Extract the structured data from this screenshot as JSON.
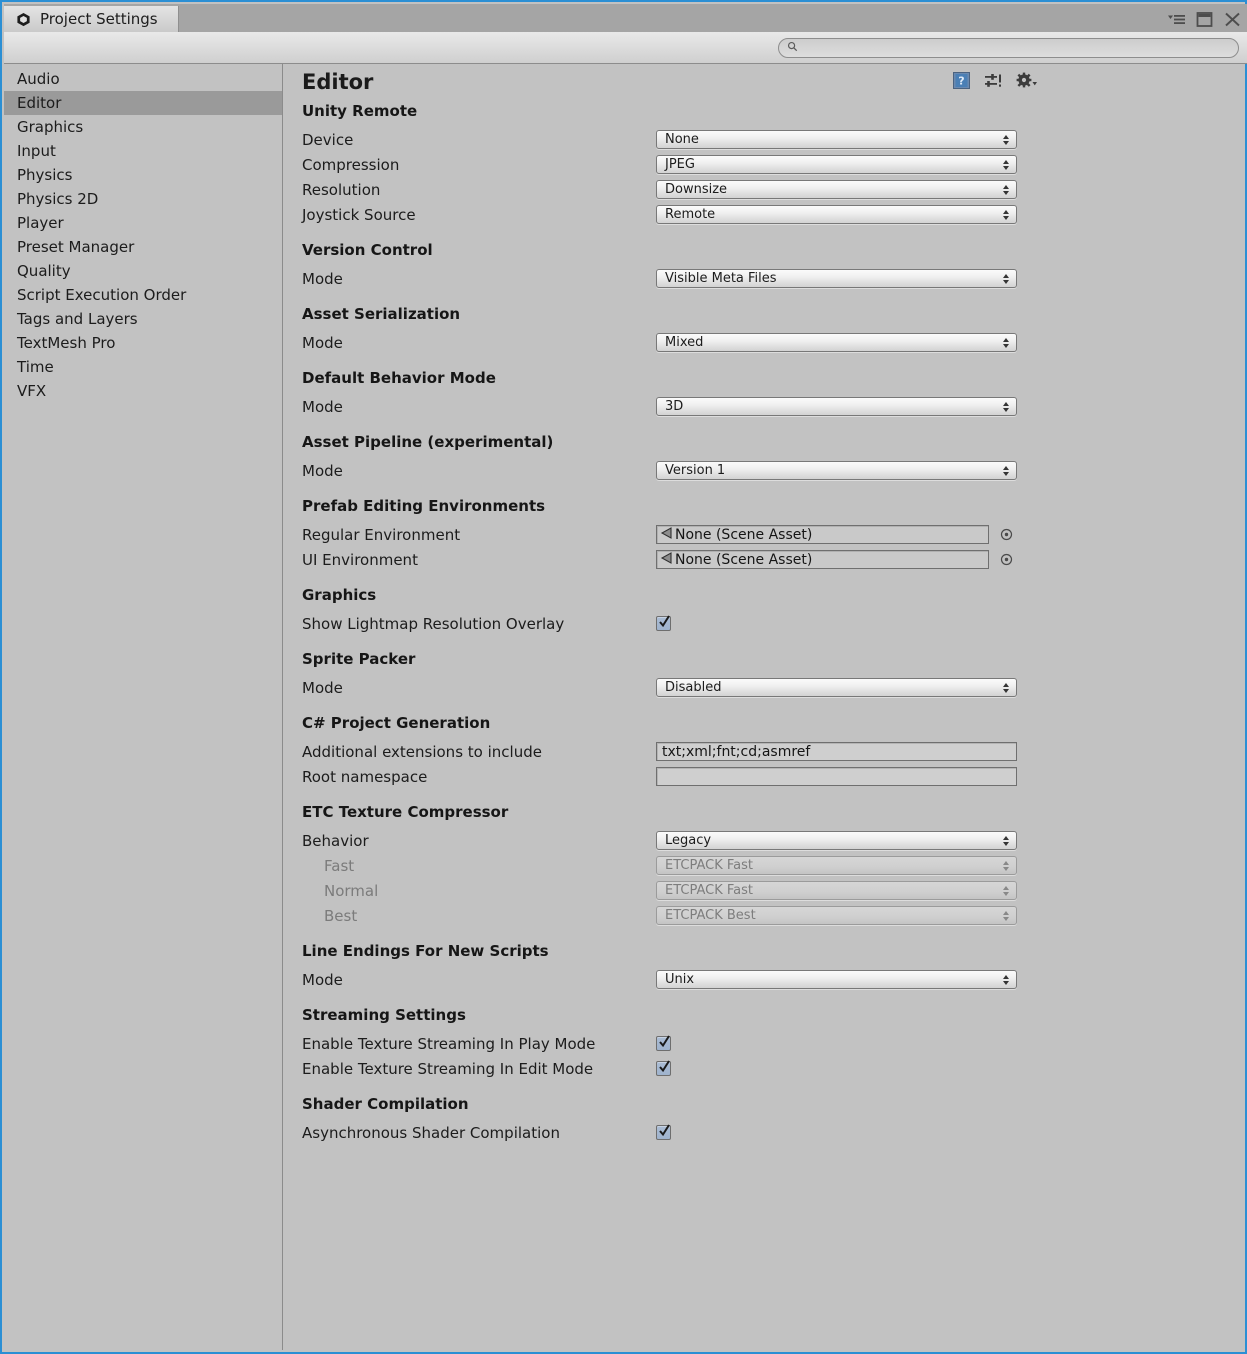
{
  "window": {
    "tab_title": "Project Settings",
    "tab_icon": "unity-logo-icon",
    "menu_button_icon": "window-menu-icon",
    "maximize_button_icon": "maximize-icon",
    "close_button_icon": "close-icon"
  },
  "toolbar": {
    "search_value": "",
    "search_placeholder": "",
    "search_icon": "search-icon"
  },
  "sidebar": {
    "items": [
      {
        "label": "Audio",
        "selected": false
      },
      {
        "label": "Editor",
        "selected": true
      },
      {
        "label": "Graphics",
        "selected": false
      },
      {
        "label": "Input",
        "selected": false
      },
      {
        "label": "Physics",
        "selected": false
      },
      {
        "label": "Physics 2D",
        "selected": false
      },
      {
        "label": "Player",
        "selected": false
      },
      {
        "label": "Preset Manager",
        "selected": false
      },
      {
        "label": "Quality",
        "selected": false
      },
      {
        "label": "Script Execution Order",
        "selected": false
      },
      {
        "label": "Tags and Layers",
        "selected": false
      },
      {
        "label": "TextMesh Pro",
        "selected": false
      },
      {
        "label": "Time",
        "selected": false
      },
      {
        "label": "VFX",
        "selected": false
      }
    ]
  },
  "page": {
    "title": "Editor",
    "icons": [
      {
        "name": "help-icon"
      },
      {
        "name": "preset-icon"
      },
      {
        "name": "gear-dropdown-icon"
      }
    ]
  },
  "sections": {
    "unity_remote": {
      "title": "Unity Remote",
      "device_label": "Device",
      "device_value": "None",
      "compression_label": "Compression",
      "compression_value": "JPEG",
      "resolution_label": "Resolution",
      "resolution_value": "Downsize",
      "joystick_label": "Joystick Source",
      "joystick_value": "Remote"
    },
    "version_control": {
      "title": "Version Control",
      "mode_label": "Mode",
      "mode_value": "Visible Meta Files"
    },
    "asset_serialization": {
      "title": "Asset Serialization",
      "mode_label": "Mode",
      "mode_value": "Mixed"
    },
    "default_behavior_mode": {
      "title": "Default Behavior Mode",
      "mode_label": "Mode",
      "mode_value": "3D"
    },
    "asset_pipeline": {
      "title": "Asset Pipeline (experimental)",
      "mode_label": "Mode",
      "mode_value": "Version 1"
    },
    "prefab_editing": {
      "title": "Prefab Editing Environments",
      "regular_label": "Regular Environment",
      "regular_value": "None (Scene Asset)",
      "ui_label": "UI Environment",
      "ui_value": "None (Scene Asset)"
    },
    "graphics": {
      "title": "Graphics",
      "lightmap_label": "Show Lightmap Resolution Overlay",
      "lightmap_checked": true
    },
    "sprite_packer": {
      "title": "Sprite Packer",
      "mode_label": "Mode",
      "mode_value": "Disabled"
    },
    "csharp_project": {
      "title": "C# Project Generation",
      "extensions_label": "Additional extensions to include",
      "extensions_value": "txt;xml;fnt;cd;asmref",
      "namespace_label": "Root namespace",
      "namespace_value": "",
      "namespace_placeholder": ""
    },
    "etc_compressor": {
      "title": "ETC Texture Compressor",
      "behavior_label": "Behavior",
      "behavior_value": "Legacy",
      "fast_label": "Fast",
      "fast_value": "ETCPACK Fast",
      "normal_label": "Normal",
      "normal_value": "ETCPACK Fast",
      "best_label": "Best",
      "best_value": "ETCPACK Best"
    },
    "line_endings": {
      "title": "Line Endings For New Scripts",
      "mode_label": "Mode",
      "mode_value": "Unix"
    },
    "streaming": {
      "title": "Streaming Settings",
      "play_label": "Enable Texture Streaming In Play Mode",
      "play_checked": true,
      "edit_label": "Enable Texture Streaming In Edit Mode",
      "edit_checked": true
    },
    "shader_compilation": {
      "title": "Shader Compilation",
      "async_label": "Asynchronous Shader Compilation",
      "async_checked": true
    }
  },
  "colors": {
    "window_border": "#2b8fd4",
    "background": "#c2c2c2",
    "selection": "#9a9a9a",
    "checkbox": "#a4b7d1"
  }
}
